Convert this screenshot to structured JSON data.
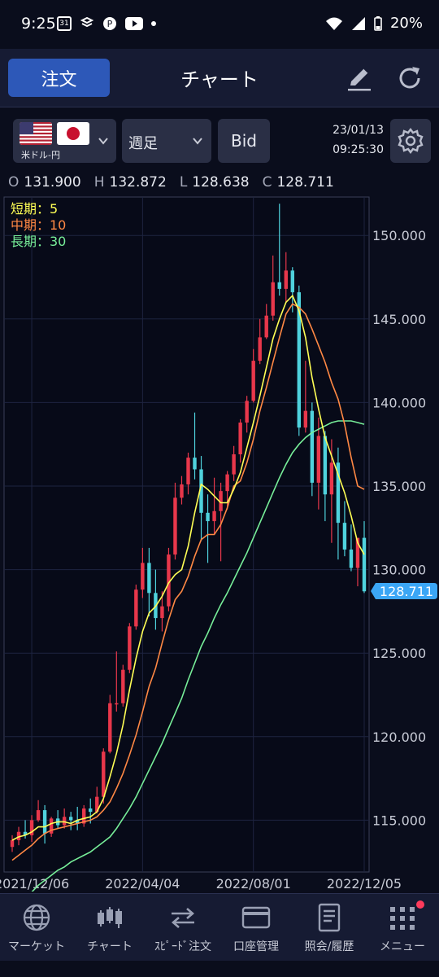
{
  "status_bar": {
    "time": "9:25",
    "calendar_day": "31",
    "battery": "20%"
  },
  "header": {
    "order_label": "注文",
    "title": "チャート"
  },
  "controls": {
    "pair_label": "米ドル-円",
    "period": "週足",
    "price_type": "Bid",
    "date": "23/01/13",
    "time": "09:25:30"
  },
  "ohlc": {
    "o_label": "O",
    "o": "131.900",
    "h_label": "H",
    "h": "132.872",
    "l_label": "L",
    "l": "128.638",
    "c_label": "C",
    "c": "128.711"
  },
  "colors": {
    "up": "#e8374b",
    "down": "#4fd2dd",
    "ma_short": "#ffff55",
    "ma_mid": "#ff8844",
    "ma_long": "#77ee99",
    "current_price": "#3ba6f5"
  },
  "chart_data": {
    "type": "candlestick",
    "legend": [
      {
        "label": "短期：5",
        "color": "#ffff55"
      },
      {
        "label": "中期：10",
        "color": "#ff8844"
      },
      {
        "label": "長期：30",
        "color": "#77ee99"
      }
    ],
    "y_ticks": [
      "150.000",
      "145.000",
      "140.000",
      "135.000",
      "130.000",
      "125.000",
      "120.000",
      "115.000"
    ],
    "y_tick_values": [
      150,
      145,
      140,
      135,
      130,
      125,
      120,
      115
    ],
    "ylim": [
      111.9,
      152.3
    ],
    "x_ticks": [
      "2021/12/06",
      "2022/04/04",
      "2022/08/01",
      "2022/12/05"
    ],
    "x_tick_index": [
      3,
      20,
      37,
      54
    ],
    "current_price": "128.711",
    "candles": [
      [
        113.4,
        114.1,
        113.1,
        113.8
      ],
      [
        113.8,
        114.6,
        113.5,
        114.3
      ],
      [
        114.3,
        115.0,
        113.9,
        114.1
      ],
      [
        114.1,
        115.3,
        113.7,
        115.0
      ],
      [
        115.0,
        116.2,
        114.9,
        115.6
      ],
      [
        115.6,
        115.9,
        113.6,
        114.2
      ],
      [
        114.2,
        115.2,
        114.0,
        115.1
      ],
      [
        115.1,
        115.6,
        114.5,
        114.7
      ],
      [
        114.7,
        115.7,
        114.5,
        115.2
      ],
      [
        115.2,
        115.5,
        114.4,
        115.0
      ],
      [
        115.0,
        115.8,
        114.4,
        114.8
      ],
      [
        114.8,
        115.9,
        114.6,
        115.7
      ],
      [
        115.7,
        116.3,
        114.8,
        115.5
      ],
      [
        115.5,
        117.0,
        115.4,
        116.4
      ],
      [
        116.4,
        119.3,
        116.0,
        119.1
      ],
      [
        119.1,
        122.5,
        119.0,
        122.0
      ],
      [
        122.0,
        125.1,
        121.5,
        122.0
      ],
      [
        122.0,
        124.3,
        121.8,
        124.0
      ],
      [
        124.0,
        126.8,
        123.8,
        126.6
      ],
      [
        126.6,
        129.1,
        126.4,
        128.8
      ],
      [
        128.8,
        131.3,
        128.3,
        130.4
      ],
      [
        130.4,
        131.3,
        127.2,
        128.6
      ],
      [
        128.6,
        130.0,
        126.4,
        127.1
      ],
      [
        127.1,
        128.7,
        126.3,
        127.8
      ],
      [
        127.8,
        131.3,
        127.5,
        130.9
      ],
      [
        130.9,
        135.2,
        130.6,
        134.3
      ],
      [
        134.3,
        135.6,
        133.9,
        135.1
      ],
      [
        135.1,
        137.0,
        134.5,
        136.7
      ],
      [
        136.7,
        139.4,
        135.4,
        136.0
      ],
      [
        136.0,
        136.8,
        131.7,
        133.4
      ],
      [
        133.4,
        134.5,
        130.4,
        132.9
      ],
      [
        132.9,
        135.5,
        132.1,
        133.5
      ],
      [
        133.5,
        135.2,
        130.5,
        134.7
      ],
      [
        134.7,
        135.9,
        133.6,
        135.7
      ],
      [
        135.7,
        137.4,
        135.3,
        136.9
      ],
      [
        136.9,
        139.0,
        136.4,
        138.8
      ],
      [
        138.8,
        140.4,
        138.2,
        140.1
      ],
      [
        140.1,
        143.2,
        140.0,
        142.5
      ],
      [
        142.5,
        145.0,
        142.3,
        143.9
      ],
      [
        143.9,
        145.9,
        143.8,
        145.2
      ],
      [
        145.2,
        148.8,
        144.9,
        147.2
      ],
      [
        147.2,
        151.9,
        146.4,
        146.8
      ],
      [
        146.8,
        149.0,
        146.0,
        147.9
      ],
      [
        147.9,
        148.1,
        145.4,
        146.6
      ],
      [
        146.6,
        147.0,
        138.0,
        138.5
      ],
      [
        138.5,
        142.5,
        138.2,
        139.5
      ],
      [
        139.5,
        140.0,
        134.4,
        135.2
      ],
      [
        135.2,
        139.1,
        133.6,
        138.0
      ],
      [
        138.0,
        138.3,
        132.9,
        134.5
      ],
      [
        134.5,
        137.8,
        131.6,
        136.4
      ],
      [
        136.4,
        137.3,
        130.6,
        132.8
      ],
      [
        132.8,
        134.1,
        130.8,
        131.2
      ],
      [
        131.2,
        132.7,
        129.9,
        130.1
      ],
      [
        130.1,
        131.6,
        129.0,
        131.9
      ],
      [
        131.9,
        132.9,
        128.6,
        128.7
      ]
    ],
    "ma_short": [
      113.8,
      114.0,
      114.1,
      114.3,
      114.6,
      114.6,
      114.8,
      114.9,
      114.9,
      114.8,
      115.0,
      115.1,
      115.2,
      115.5,
      116.3,
      117.6,
      119.0,
      120.7,
      122.8,
      124.7,
      126.3,
      127.4,
      127.8,
      128.4,
      129.2,
      129.7,
      130.0,
      131.4,
      133.4,
      135.1,
      134.8,
      134.4,
      134.0,
      134.0,
      134.8,
      135.8,
      137.3,
      138.8,
      140.4,
      142.1,
      143.8,
      145.0,
      146.0,
      146.4,
      145.5,
      143.9,
      141.5,
      139.6,
      137.9,
      136.8,
      135.7,
      134.6,
      133.2,
      131.6,
      130.9
    ],
    "ma_mid": [
      112.6,
      112.9,
      113.2,
      113.5,
      113.9,
      114.2,
      114.4,
      114.5,
      114.6,
      114.7,
      114.8,
      114.9,
      115.0,
      115.2,
      115.6,
      116.1,
      116.9,
      117.8,
      118.9,
      120.1,
      121.5,
      123.0,
      124.1,
      125.6,
      127.0,
      128.2,
      128.7,
      129.6,
      130.8,
      131.8,
      132.1,
      132.1,
      132.7,
      133.7,
      135.0,
      135.3,
      136.4,
      137.8,
      139.5,
      140.9,
      142.4,
      143.9,
      145.3,
      145.9,
      145.7,
      145.3,
      144.4,
      143.4,
      142.4,
      141.2,
      140.2,
      138.7,
      136.7,
      135.0,
      134.8
    ],
    "ma_long": [
      109.5,
      109.9,
      110.3,
      110.7,
      111.1,
      111.4,
      111.7,
      112.0,
      112.2,
      112.5,
      112.7,
      112.9,
      113.1,
      113.4,
      113.7,
      114.0,
      114.5,
      115.1,
      115.7,
      116.4,
      117.2,
      118.0,
      118.8,
      119.6,
      120.5,
      121.4,
      122.3,
      123.4,
      124.4,
      125.4,
      126.2,
      127.1,
      127.9,
      128.6,
      129.4,
      130.2,
      131.0,
      131.9,
      132.8,
      133.7,
      134.6,
      135.5,
      136.3,
      137.0,
      137.5,
      137.9,
      138.2,
      138.4,
      138.6,
      138.8,
      138.9,
      138.9,
      138.9,
      138.8,
      138.7
    ]
  },
  "nav": [
    {
      "label": "マーケット"
    },
    {
      "label": "チャート"
    },
    {
      "label": "ｽﾋﾟｰﾄﾞ注文"
    },
    {
      "label": "口座管理"
    },
    {
      "label": "照会/履歴"
    },
    {
      "label": "メニュー"
    }
  ]
}
